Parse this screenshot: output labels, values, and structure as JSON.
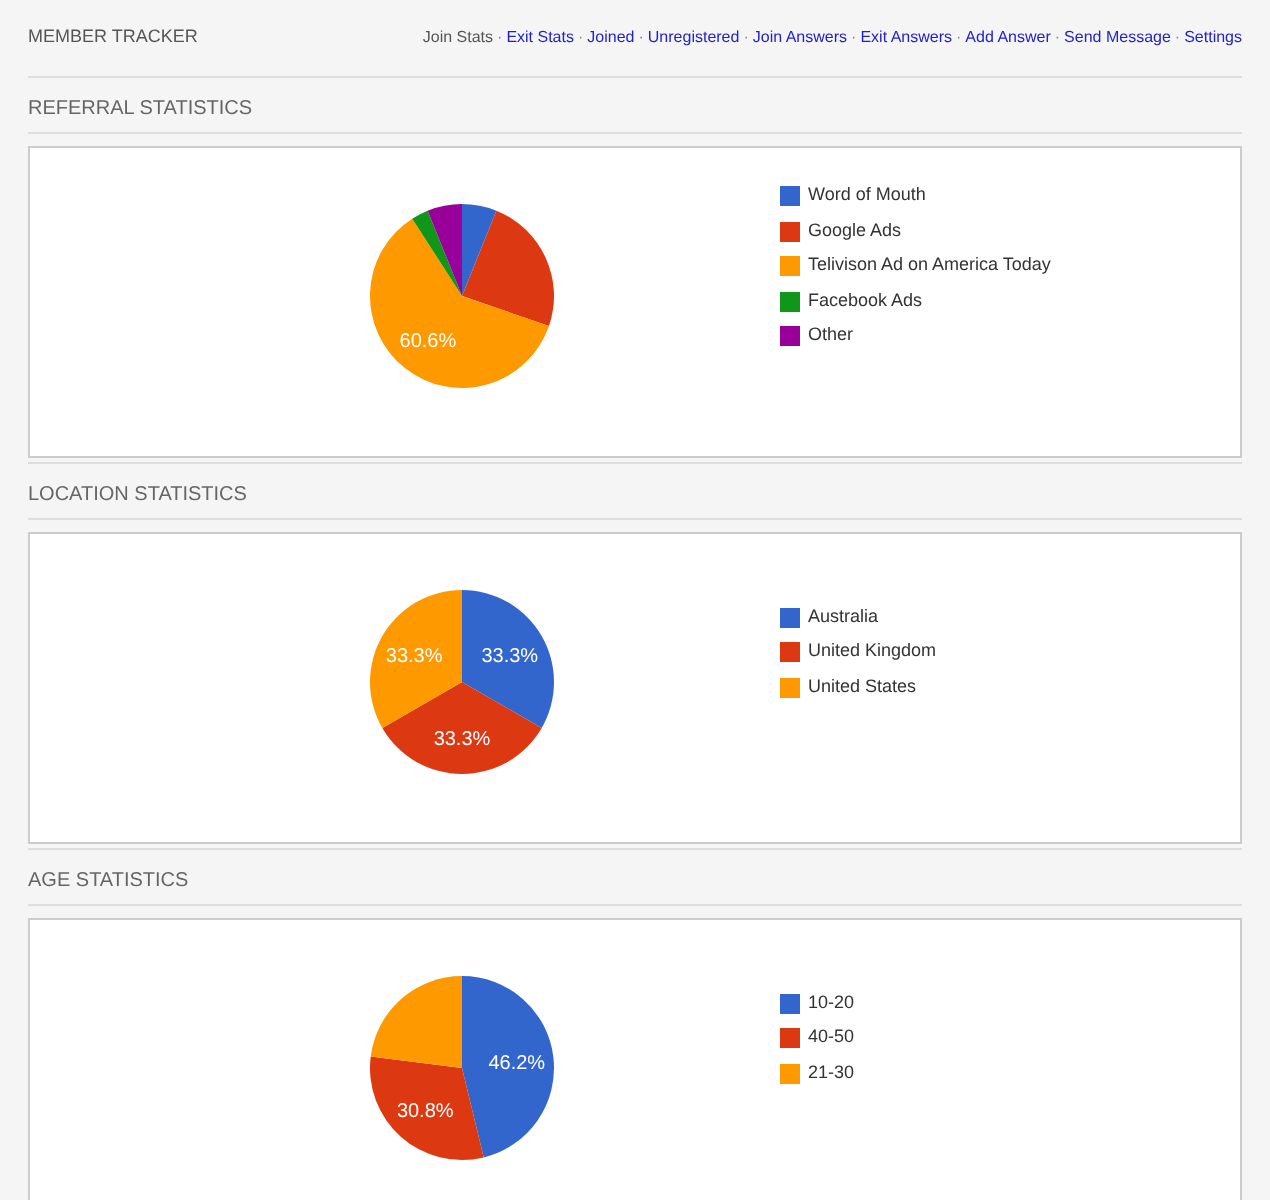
{
  "app_title": "MEMBER TRACKER",
  "nav_separator": "·",
  "nav": [
    {
      "label": "Join Stats",
      "selected": true
    },
    {
      "label": "Exit Stats",
      "selected": false
    },
    {
      "label": "Joined",
      "selected": false
    },
    {
      "label": "Unregistered",
      "selected": false
    },
    {
      "label": "Join Answers",
      "selected": false
    },
    {
      "label": "Exit Answers",
      "selected": false
    },
    {
      "label": "Add Answer",
      "selected": false
    },
    {
      "label": "Send Message",
      "selected": false
    },
    {
      "label": "Settings",
      "selected": false
    }
  ],
  "sections": [
    {
      "title": "REFERRAL STATISTICS",
      "chart_data": {
        "type": "pie",
        "categories": [
          "Word of Mouth",
          "Google Ads",
          "Telivison Ad on America Today",
          "Facebook Ads",
          "Other"
        ],
        "series": [
          {
            "colors": [
              "#3366cc",
              "#dc3912",
              "#ff9900",
              "#109618",
              "#990099"
            ],
            "values": [
              6.1,
              24.2,
              60.6,
              3.0,
              6.1
            ]
          }
        ],
        "value_labels": [
          null,
          null,
          "60.6%",
          null,
          null
        ]
      }
    },
    {
      "title": "LOCATION STATISTICS",
      "chart_data": {
        "type": "pie",
        "categories": [
          "Australia",
          "United Kingdom",
          "United States"
        ],
        "series": [
          {
            "colors": [
              "#3366cc",
              "#dc3912",
              "#ff9900"
            ],
            "values": [
              33.3,
              33.3,
              33.3
            ]
          }
        ],
        "value_labels": [
          "33.3%",
          "33.3%",
          "33.3%"
        ]
      }
    },
    {
      "title": "AGE STATISTICS",
      "chart_data": {
        "type": "pie",
        "categories": [
          "10-20",
          "40-50",
          "21-30"
        ],
        "series": [
          {
            "colors": [
              "#3366cc",
              "#dc3912",
              "#ff9900"
            ],
            "values": [
              46.2,
              30.8,
              23.0
            ]
          }
        ],
        "value_labels": [
          "46.2%",
          "30.8%",
          null
        ]
      }
    }
  ]
}
